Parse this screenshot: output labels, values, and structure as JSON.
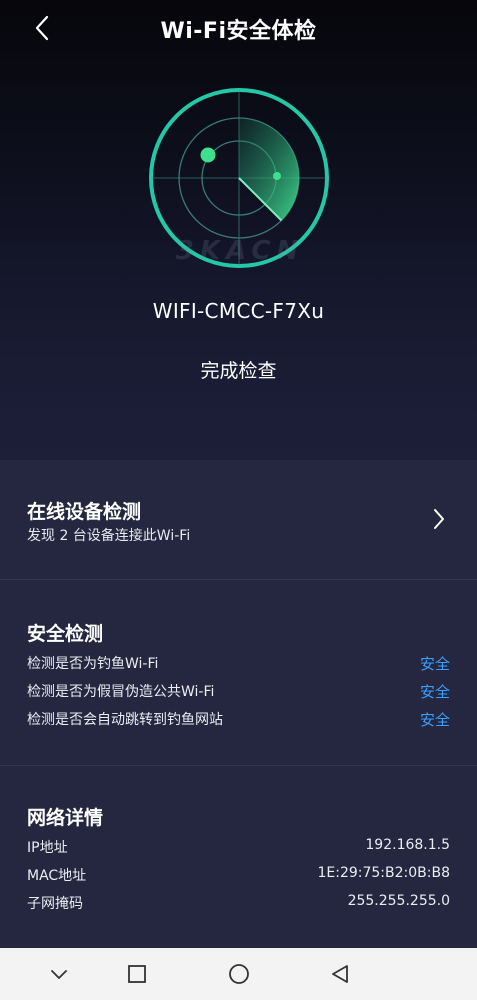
{
  "header": {
    "title": "Wi-Fi安全体检"
  },
  "hero": {
    "watermark": "3KACN",
    "ssid": "WIFI-CMCC-F7Xu",
    "status": "完成检查",
    "accent_color": "#3ee08e"
  },
  "online_devices": {
    "title": "在线设备检测",
    "subtitle": "发现 2 台设备连接此Wi-Fi"
  },
  "security_check": {
    "title": "安全检测",
    "items": [
      {
        "label": "检测是否为钓鱼Wi-Fi",
        "result": "安全"
      },
      {
        "label": "检测是否为假冒伪造公共Wi-Fi",
        "result": "安全"
      },
      {
        "label": "检测是否会自动跳转到钓鱼网站",
        "result": "安全"
      }
    ],
    "safe_color": "#3aa0ff"
  },
  "network_details": {
    "title": "网络详情",
    "items": [
      {
        "label": "IP地址",
        "value": "192.168.1.5"
      },
      {
        "label": "MAC地址",
        "value": "1E:29:75:B2:0B:B8"
      },
      {
        "label": "子网掩码",
        "value": "255.255.255.0"
      }
    ]
  },
  "navbar": {
    "buttons": [
      "chevron-down-icon",
      "square-icon",
      "circle-icon",
      "triangle-back-icon"
    ]
  }
}
